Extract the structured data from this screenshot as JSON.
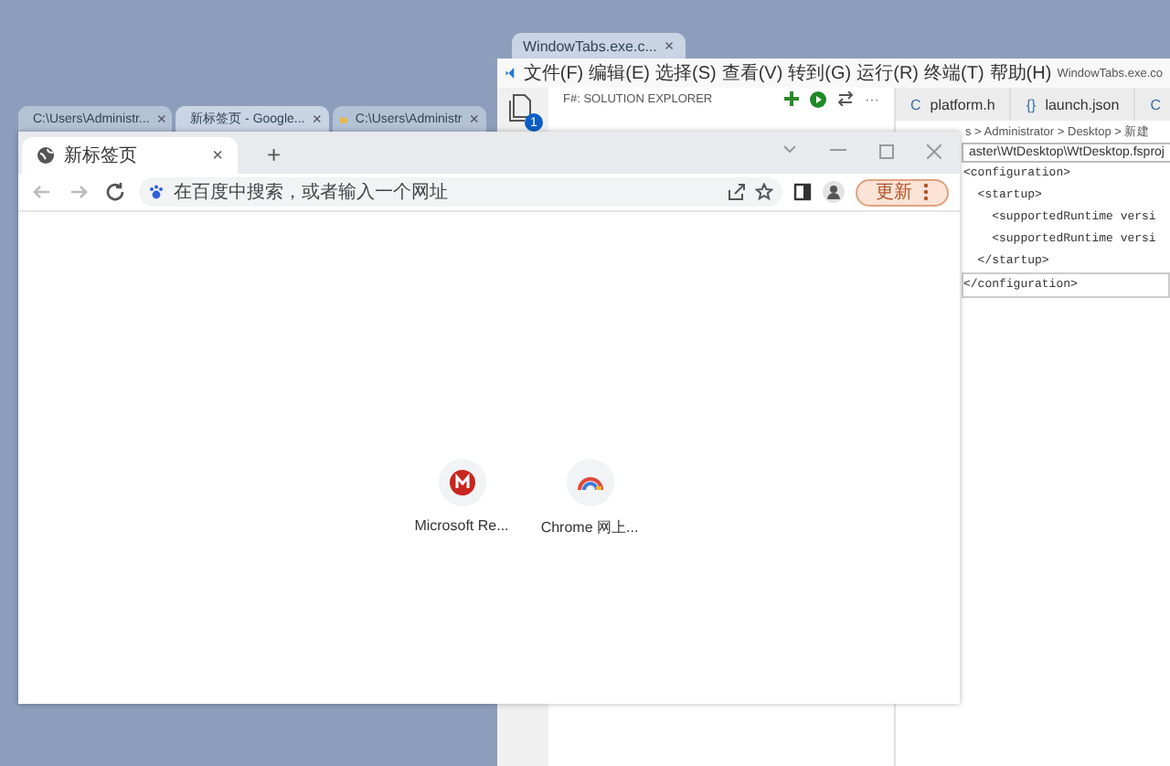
{
  "editor_window": {
    "window_tab": {
      "title": "WindowTabs.exe.c...",
      "close": "×"
    },
    "menu": [
      "文件(F)",
      "编辑(E)",
      "选择(S)",
      "查看(V)",
      "转到(G)",
      "运行(R)",
      "终端(T)",
      "帮助(H)"
    ],
    "title": "WindowTabs.exe.co",
    "activity_badge": "1",
    "explorer": {
      "title": "F#: SOLUTION EXPLORER",
      "more": "···"
    },
    "editor_tabs": [
      {
        "icon": "C",
        "label": "platform.h",
        "selected": false
      },
      {
        "icon": "{}",
        "label": "launch.json",
        "selected": false
      },
      {
        "icon": "C",
        "selected": false
      }
    ],
    "breadcrumb": "s > Administrator > Desktop > 新建",
    "path_box": "aster\\WtDesktop\\WtDesktop.fsproj",
    "code_lines": [
      "<configuration>",
      "  <startup>",
      "    <supportedRuntime versi",
      "    <supportedRuntime versi",
      "  </startup>",
      "</configuration>"
    ]
  },
  "browser_group": {
    "window_tabs": [
      {
        "title": "C:\\Users\\Administr...",
        "close": "×",
        "kind": "folder",
        "selected": false
      },
      {
        "title": "新标签页 - Google...",
        "close": "×",
        "kind": "browser",
        "selected": true
      },
      {
        "title": "C:\\Users\\Administr",
        "close": "×",
        "kind": "folder",
        "selected": false
      }
    ],
    "browser": {
      "tabs": [
        {
          "title": "新标签页",
          "close": "×",
          "selected": true
        }
      ],
      "new_tab": "+",
      "nav": [
        {
          "kind": "back",
          "disabled": true
        },
        {
          "kind": "forward",
          "disabled": true
        },
        {
          "kind": "reload",
          "disabled": false
        }
      ],
      "address": {
        "placeholder": "在百度中搜索，或者输入一个网址"
      },
      "update_button": "更新",
      "shortcuts": [
        {
          "kind": "m",
          "label": "Microsoft Re..."
        },
        {
          "kind": "store",
          "label": "Chrome 网上..."
        }
      ]
    }
  }
}
